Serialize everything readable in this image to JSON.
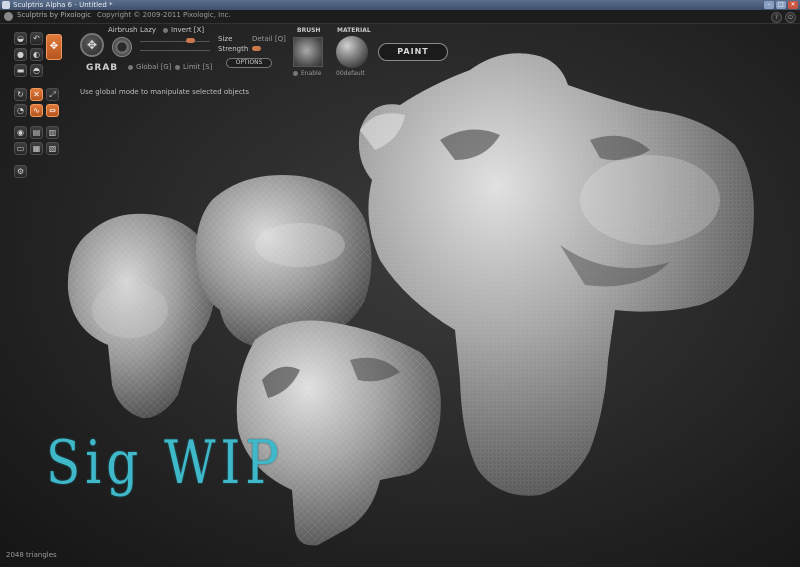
{
  "window": {
    "title": "Sculptris Alpha 6 - Untitled *"
  },
  "header": {
    "brand": "Sculptris by Pixologic",
    "copyright": "Copyright © 2009-2011 Pixologic, Inc."
  },
  "tools": {
    "active": [
      "wire-cross-tool",
      "flatten-draw-tool",
      "inflate-tool",
      "grab-tool"
    ]
  },
  "tool_options": {
    "tool_name": "GRAB",
    "airbrush_label": "Airbrush",
    "lazy_label": "Lazy",
    "invert_label": "Invert [X]",
    "size_label": "Size",
    "detail_label": "Detail [Q]",
    "strength_label": "Strength",
    "global_label": "Global [G]",
    "limit_label": "Limit [S]",
    "options_button": "OPTIONS"
  },
  "brush": {
    "label": "BRUSH",
    "enable_label": "Enable"
  },
  "material": {
    "label": "MATERIAL",
    "name": "00default"
  },
  "paint_button": "PAINT",
  "hint": "Use global mode to manipulate selected objects",
  "status": {
    "triangles": "2048 triangles"
  },
  "viewport": {
    "overlay_text": "Sig WIP",
    "accent_color": "#3fb8c9"
  }
}
